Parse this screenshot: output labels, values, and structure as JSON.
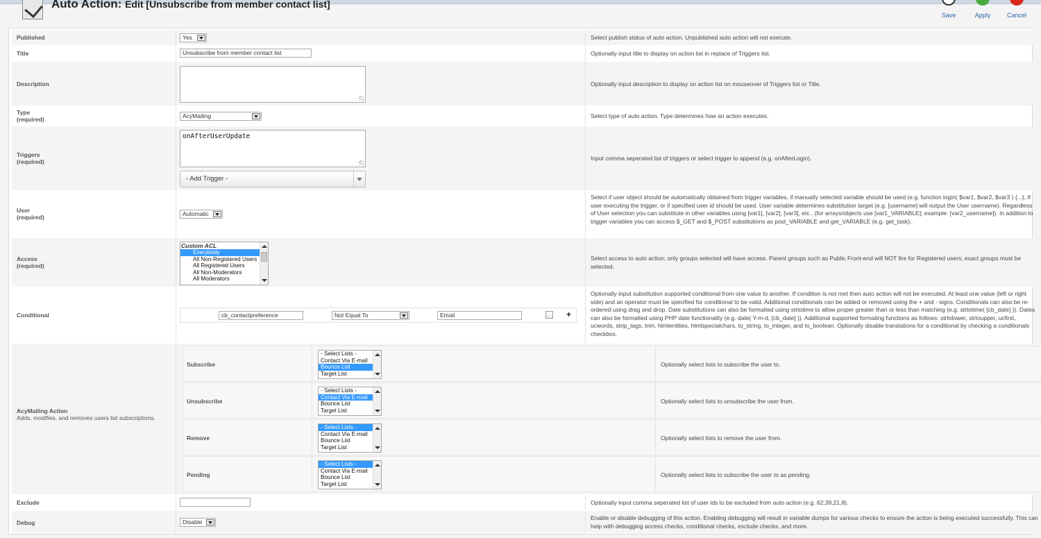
{
  "header": {
    "title": "Auto Action:",
    "subtitle": "Edit [Unsubscribe from member contact list]",
    "toolbar": {
      "save_label": "Save",
      "apply_label": "Apply",
      "cancel_label": "Cancel"
    }
  },
  "form": {
    "published": {
      "label": "Published",
      "value": "Yes",
      "description": "Select publish status of auto action. Unpublished auto action will not execute."
    },
    "title": {
      "label": "Title",
      "value": "Unsubscribe from member contact list",
      "description": "Optionally input title to display on action list in replace of Triggers list."
    },
    "description": {
      "label": "Description",
      "value": "",
      "description": "Optionally input description to display on action list on mouseover of Triggers list or Title."
    },
    "type": {
      "label": "Type",
      "required": "(required)",
      "value": "AcyMailing",
      "description": "Select type of auto action. Type determines how an action executes."
    },
    "triggers": {
      "label": "Triggers",
      "required": "(required)",
      "value": "onAfterUserUpdate",
      "add_trigger": "- Add Trigger -",
      "description": "Input comma seperated list of triggers or select trigger to append (e.g. onAfterLogin)."
    },
    "user": {
      "label": "User",
      "required": "(required)",
      "value": "Automatic",
      "description": "Select if user object should be automatically obtained from trigger variables, if manually selected variable should be used (e.g. function login( $var1, $var2, $var3 ) {...}, if user executing the trigger, or if specified user id should be used. User variable determines substitution target (e.g. [username] will output the User username). Regardless of User selection you can substitute in other variables using [var1], [var2], [var3], etc.. (for arrays/objects use [var1_VARIABLE]; example: [var2_username]). In addition to trigger variables you can access $_GET and $_POST substitutions as post_VARIABLE and get_VARIABLE (e.g. get_task)."
    },
    "access": {
      "label": "Access",
      "required": "(required)",
      "group": "Custom ACL",
      "options": [
        "Everybody",
        "All Non-Registered Users",
        "All Registered Users",
        "All Non-Moderators",
        "All Moderators"
      ],
      "selected": "Everybody",
      "description": "Select access to auto action; only groups selected will have access. Parent groups such as Public Front-end will NOT fire for Registered users; exact groups must be selected."
    },
    "conditional": {
      "label": "Conditional",
      "field": "cb_contactpreference",
      "operator": "Not Equal To",
      "value": "Email",
      "add": "+",
      "description": "Optionally input substitution supported conditional from one value to another. If condition is not met then auto action will not be executed. At least one value (left or right side) and an operator must be specified for conditional to be valid. Additional conditionals can be added or removed using the + and - signs. Conditionals can also be re-ordered using drag and drop. Date substitutions can also be formatted using strtotime to allow proper greater than or less than matching (e.g. strtotime( [cb_date] )). Dates can also be formatted using PHP date functionality (e.g. date( Y-m-d, [cb_date] )). Additional supported formating functions as follows: strtolower, strtoupper, ucfirst, ucwords, strip_tags, trim, htmlentities, htmlspecialchars, to_string, to_integer, and to_boolean. Optionally disable translations for a conditional by checking a conditionals checkbox."
    },
    "acymailing": {
      "label": "AcyMailing Action",
      "sublabel": "Adds, modifies, and removes users list subscriptions.",
      "list_options": [
        "- Select Lists -",
        "Contact Via E-mail",
        "Bounce List",
        "Target List"
      ],
      "rows": [
        {
          "label": "Subscribe",
          "selected": 2,
          "description": "Optionally select lists to subscribe the user to."
        },
        {
          "label": "Unsubscribe",
          "selected": 1,
          "description": "Optionally select lists to unsubscribe the user from."
        },
        {
          "label": "Remove",
          "selected": 0,
          "description": "Optionally select lists to remove the user from."
        },
        {
          "label": "Pending",
          "selected": 0,
          "description": "Optionally select lists to subscribe the user to as pending."
        }
      ]
    },
    "exclude": {
      "label": "Exclude",
      "value": "",
      "description": "Optionally input comma seperated list of user ids to be excluded from auto action (e.g. 62,39,21,8)."
    },
    "debug": {
      "label": "Debug",
      "value": "Disable",
      "description": "Enable or disable debugging of this action. Enabling debugging will result in variable dumps for various checks to ensure the action is being executed successfully. This can help with debugging access checks, conditional checks, exclude checks, and more."
    }
  }
}
